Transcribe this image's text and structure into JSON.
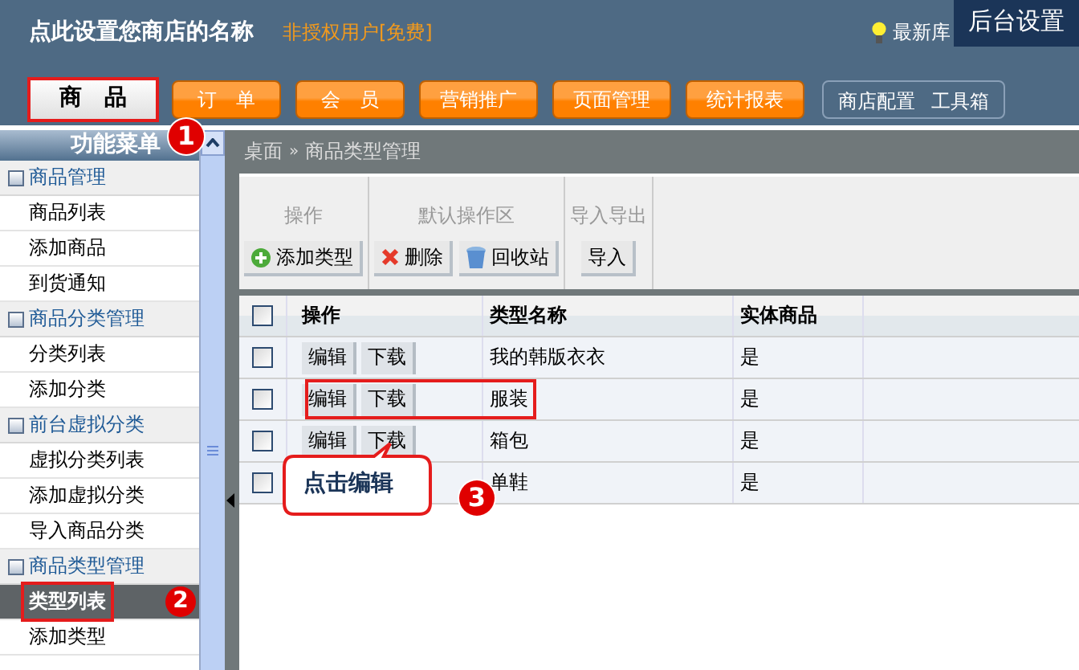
{
  "header": {
    "shop_name": "点此设置您商店的名称",
    "license": "非授权用户[免费]",
    "notice": "最新库",
    "panel_title": "后台设置"
  },
  "nav_tabs": [
    {
      "label": "商　品",
      "selected": true
    },
    {
      "label": "订　单",
      "selected": false
    },
    {
      "label": "会　员",
      "selected": false
    },
    {
      "label": "营销推广",
      "selected": false
    },
    {
      "label": "页面管理",
      "selected": false
    },
    {
      "label": "统计报表",
      "selected": false
    }
  ],
  "nav_links": [
    "商店配置",
    "工具箱"
  ],
  "sidebar": {
    "title": "功能菜单",
    "groups": [
      {
        "label": "商品管理",
        "children": [
          {
            "label": "商品列表",
            "selected": false
          },
          {
            "label": "添加商品",
            "selected": false
          },
          {
            "label": "到货通知",
            "selected": false
          }
        ]
      },
      {
        "label": "商品分类管理",
        "children": [
          {
            "label": "分类列表",
            "selected": false
          },
          {
            "label": "添加分类",
            "selected": false
          }
        ]
      },
      {
        "label": "前台虚拟分类",
        "children": [
          {
            "label": "虚拟分类列表",
            "selected": false
          },
          {
            "label": "添加虚拟分类",
            "selected": false
          },
          {
            "label": "导入商品分类",
            "selected": false
          }
        ]
      },
      {
        "label": "商品类型管理",
        "children": [
          {
            "label": "类型列表",
            "selected": true,
            "highlighted": true
          },
          {
            "label": "添加类型",
            "selected": false
          }
        ]
      }
    ]
  },
  "breadcrumb": [
    "桌面",
    "»",
    "商品类型管理"
  ],
  "toolbar": [
    {
      "title": "操作",
      "buttons": [
        {
          "label": "添加类型",
          "kind": "add"
        }
      ]
    },
    {
      "title": "默认操作区",
      "buttons": [
        {
          "label": "删除",
          "kind": "delete"
        },
        {
          "label": "回收站",
          "kind": "bin"
        }
      ]
    },
    {
      "title": "导入导出",
      "buttons": [
        {
          "label": "导入",
          "kind": "plain"
        }
      ]
    }
  ],
  "table": {
    "select_all": {
      "checked": false
    },
    "columns": [
      "操作",
      "类型名称",
      "实体商品"
    ],
    "rows": [
      {
        "checked": false,
        "actions": [
          "编辑",
          "下载"
        ],
        "name": "我的韩版衣衣",
        "physical": "是"
      },
      {
        "checked": false,
        "actions": [
          "编辑",
          "下载"
        ],
        "name": "服装",
        "physical": "是",
        "highlighted": true
      },
      {
        "checked": false,
        "actions": [
          "编辑",
          "下载"
        ],
        "name": "箱包",
        "physical": "是"
      },
      {
        "checked": false,
        "name": "单鞋",
        "physical": "是"
      }
    ]
  },
  "annotations": [
    {
      "kind": "badge",
      "text": "1"
    },
    {
      "kind": "badge",
      "text": "2"
    },
    {
      "kind": "badge",
      "text": "3"
    },
    {
      "kind": "callout",
      "text": "点击编辑"
    }
  ]
}
